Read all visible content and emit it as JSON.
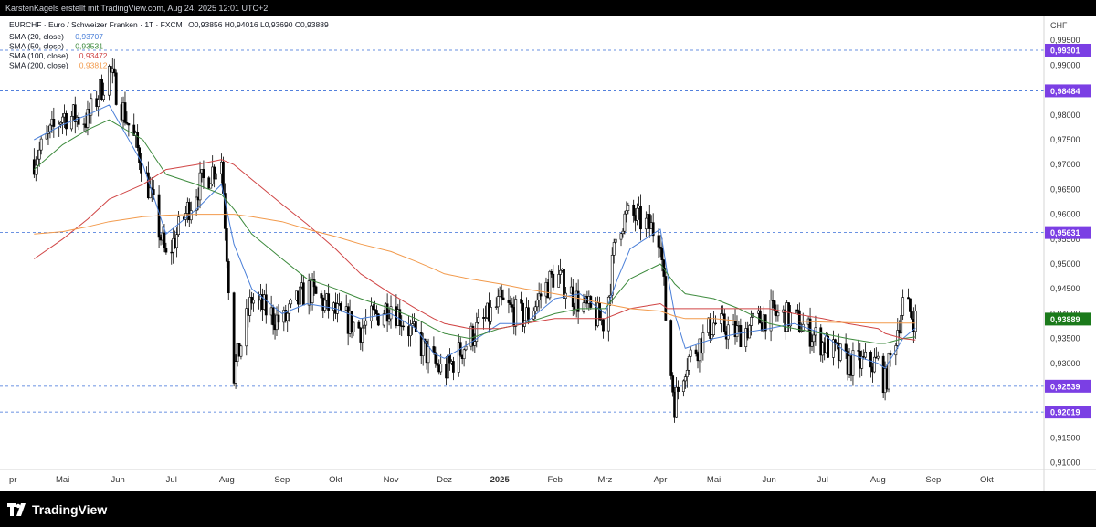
{
  "header": {
    "caption": "KarstenKagels erstellt mit TradingView.com, Aug 24, 2025 12:01 UTC+2"
  },
  "legend": {
    "symbol_line": "EURCHF · Euro / Schweizer Franken · 1T · FXCM",
    "ohlc": "O0,93856  H0,94016  L0,93690  C0,93889",
    "indicators": [
      {
        "label": "SMA (20, close)",
        "value": "0,93707",
        "color": "#4a7fd8"
      },
      {
        "label": "SMA (50, close)",
        "value": "0,93531",
        "color": "#3c8a3c"
      },
      {
        "label": "SMA (100, close)",
        "value": "0,93472",
        "color": "#d04545"
      },
      {
        "label": "SMA (200, close)",
        "value": "0,93812",
        "color": "#f29a4c"
      }
    ]
  },
  "price_axis": {
    "currency": "CHF",
    "ticks": [
      "0,99500",
      "0,99000",
      "0,98500",
      "0,98000",
      "0,97500",
      "0,97000",
      "0,96500",
      "0,96000",
      "0,95500",
      "0,95000",
      "0,94500",
      "0,94000",
      "0,93500",
      "0,93000",
      "0,92500",
      "0,92000",
      "0,91500",
      "0,91000"
    ],
    "tags": [
      {
        "label": "0,99301",
        "kind": "level"
      },
      {
        "label": "0,98484",
        "kind": "level"
      },
      {
        "label": "0,95631",
        "kind": "level"
      },
      {
        "label": "0,93889",
        "kind": "last"
      },
      {
        "label": "0,92539",
        "kind": "level"
      },
      {
        "label": "0,92019",
        "kind": "level"
      }
    ]
  },
  "time_axis": {
    "ticks": [
      "pr",
      "Mai",
      "Jun",
      "Jul",
      "Aug",
      "Sep",
      "Okt",
      "Nov",
      "Dez",
      "2025",
      "Feb",
      "Mrz",
      "Apr",
      "Mai",
      "Jun",
      "Jul",
      "Aug",
      "Sep",
      "Okt"
    ]
  },
  "footer": {
    "brand": "TradingView"
  },
  "colors": {
    "candle_up": "#26a69a",
    "candle_down": "#ef5350",
    "candle_body": "#000000",
    "level_line": "#3a6fd8",
    "level_tag_bg": "#7b3fe4",
    "last_tag_bg": "#1b7a1b"
  },
  "chart_data": {
    "type": "line",
    "title": "EURCHF · Euro / Schweizer Franken · 1T · FXCM",
    "xlabel": "",
    "ylabel": "CHF",
    "ylim": [
      0.909,
      0.9965
    ],
    "grid": false,
    "legend_position": "top-left",
    "x": [
      "2024-04-15",
      "2024-05-01",
      "2024-05-15",
      "2024-05-27",
      "2024-06-15",
      "2024-06-28",
      "2024-07-15",
      "2024-07-29",
      "2024-08-05",
      "2024-08-15",
      "2024-09-01",
      "2024-09-15",
      "2024-10-01",
      "2024-10-15",
      "2024-11-01",
      "2024-11-15",
      "2024-11-25",
      "2024-12-01",
      "2024-12-15",
      "2025-01-01",
      "2025-01-15",
      "2025-02-01",
      "2025-02-15",
      "2025-03-01",
      "2025-03-08",
      "2025-03-15",
      "2025-04-01",
      "2025-04-05",
      "2025-04-09",
      "2025-04-15",
      "2025-05-01",
      "2025-05-15",
      "2025-06-01",
      "2025-06-15",
      "2025-07-01",
      "2025-07-15",
      "2025-08-01",
      "2025-08-05",
      "2025-08-15",
      "2025-08-22"
    ],
    "price_path": [
      0.971,
      0.98,
      0.979,
      0.989,
      0.97,
      0.951,
      0.965,
      0.971,
      0.928,
      0.943,
      0.938,
      0.945,
      0.94,
      0.937,
      0.942,
      0.935,
      0.93,
      0.928,
      0.935,
      0.942,
      0.939,
      0.948,
      0.942,
      0.938,
      0.958,
      0.96,
      0.956,
      0.934,
      0.922,
      0.93,
      0.938,
      0.936,
      0.94,
      0.939,
      0.934,
      0.93,
      0.93,
      0.926,
      0.942,
      0.9389
    ],
    "series": [
      {
        "name": "SMA (20, close)",
        "values": [
          0.975,
          0.978,
          0.98,
          0.982,
          0.97,
          0.956,
          0.961,
          0.966,
          0.954,
          0.945,
          0.94,
          0.942,
          0.941,
          0.939,
          0.94,
          0.937,
          0.932,
          0.931,
          0.934,
          0.938,
          0.938,
          0.943,
          0.944,
          0.94,
          0.947,
          0.953,
          0.957,
          0.948,
          0.94,
          0.933,
          0.935,
          0.936,
          0.937,
          0.938,
          0.936,
          0.932,
          0.93,
          0.929,
          0.935,
          0.9371
        ]
      },
      {
        "name": "SMA (50, close)",
        "values": [
          0.969,
          0.974,
          0.977,
          0.979,
          0.975,
          0.968,
          0.966,
          0.964,
          0.961,
          0.956,
          0.951,
          0.947,
          0.945,
          0.943,
          0.941,
          0.939,
          0.937,
          0.936,
          0.935,
          0.937,
          0.938,
          0.94,
          0.941,
          0.941,
          0.944,
          0.947,
          0.95,
          0.948,
          0.946,
          0.944,
          0.943,
          0.941,
          0.938,
          0.937,
          0.936,
          0.935,
          0.934,
          0.934,
          0.935,
          0.9353
        ]
      },
      {
        "name": "SMA (100, close)",
        "values": [
          0.951,
          0.955,
          0.959,
          0.963,
          0.966,
          0.969,
          0.97,
          0.971,
          0.97,
          0.967,
          0.962,
          0.958,
          0.953,
          0.948,
          0.944,
          0.941,
          0.939,
          0.938,
          0.937,
          0.937,
          0.938,
          0.939,
          0.939,
          0.939,
          0.94,
          0.941,
          0.942,
          0.941,
          0.941,
          0.941,
          0.941,
          0.941,
          0.941,
          0.94,
          0.939,
          0.938,
          0.937,
          0.936,
          0.935,
          0.9347
        ]
      },
      {
        "name": "SMA (200, close)",
        "values": [
          0.956,
          0.9565,
          0.9575,
          0.9585,
          0.9595,
          0.9598,
          0.96,
          0.96,
          0.96,
          0.9595,
          0.9585,
          0.957,
          0.9555,
          0.954,
          0.9525,
          0.9505,
          0.949,
          0.948,
          0.947,
          0.946,
          0.945,
          0.944,
          0.943,
          0.942,
          0.9415,
          0.941,
          0.9405,
          0.94,
          0.9395,
          0.939,
          0.939,
          0.9385,
          0.9385,
          0.9385,
          0.9383,
          0.9382,
          0.9381,
          0.9381,
          0.9381,
          0.9381
        ]
      }
    ],
    "levels": [
      0.99301,
      0.98484,
      0.95631,
      0.92539,
      0.92019
    ],
    "last_price": 0.93889
  }
}
